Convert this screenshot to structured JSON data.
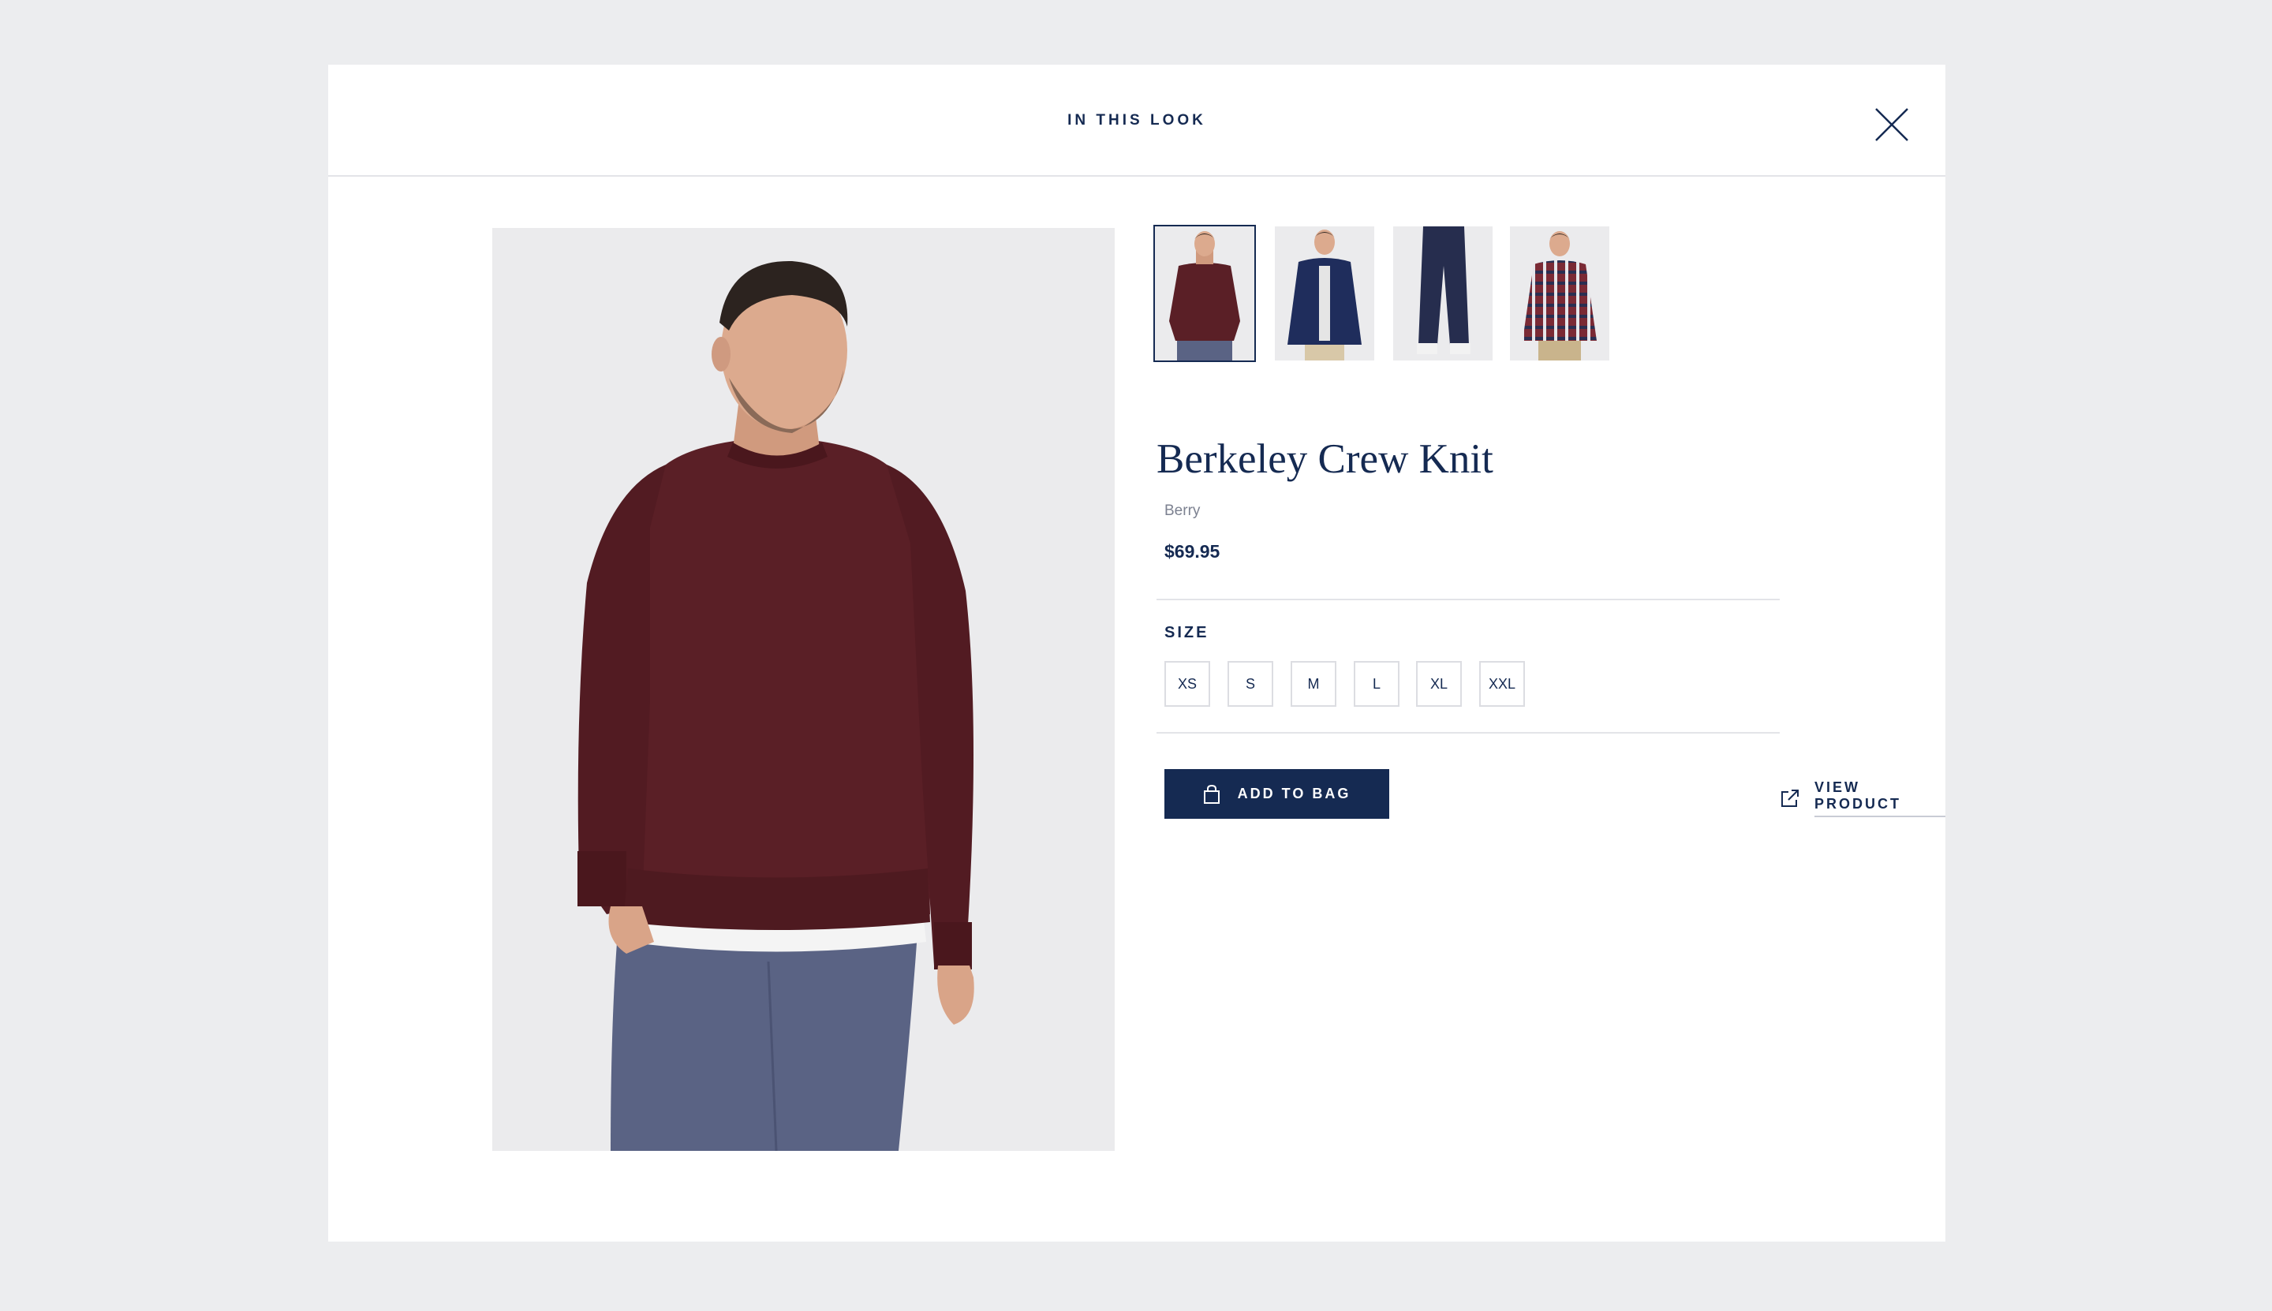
{
  "modal": {
    "title": "IN THIS LOOK"
  },
  "icons": {
    "close": "close-icon",
    "bag": "shopping-bag-icon",
    "external": "external-link-icon"
  },
  "colors": {
    "navy": "#152a52",
    "burgundy": "#5a1f26",
    "chino": "#5a6384",
    "background": "#ecedef"
  },
  "hero": {
    "alt": "Model wearing a berry crew knit sweater and blue chinos"
  },
  "thumbnails": [
    {
      "name": "thumb-crew-knit",
      "selected": true
    },
    {
      "name": "thumb-navy-jacket",
      "selected": false
    },
    {
      "name": "thumb-navy-pants",
      "selected": false
    },
    {
      "name": "thumb-check-shirt",
      "selected": false
    }
  ],
  "product": {
    "name": "Berkeley Crew Knit",
    "color": "Berry",
    "price": "$69.95"
  },
  "size": {
    "label": "SIZE",
    "options": [
      "XS",
      "S",
      "M",
      "L",
      "XL",
      "XXL"
    ]
  },
  "actions": {
    "add_to_bag": "ADD TO BAG",
    "view_product": "VIEW PRODUCT"
  }
}
